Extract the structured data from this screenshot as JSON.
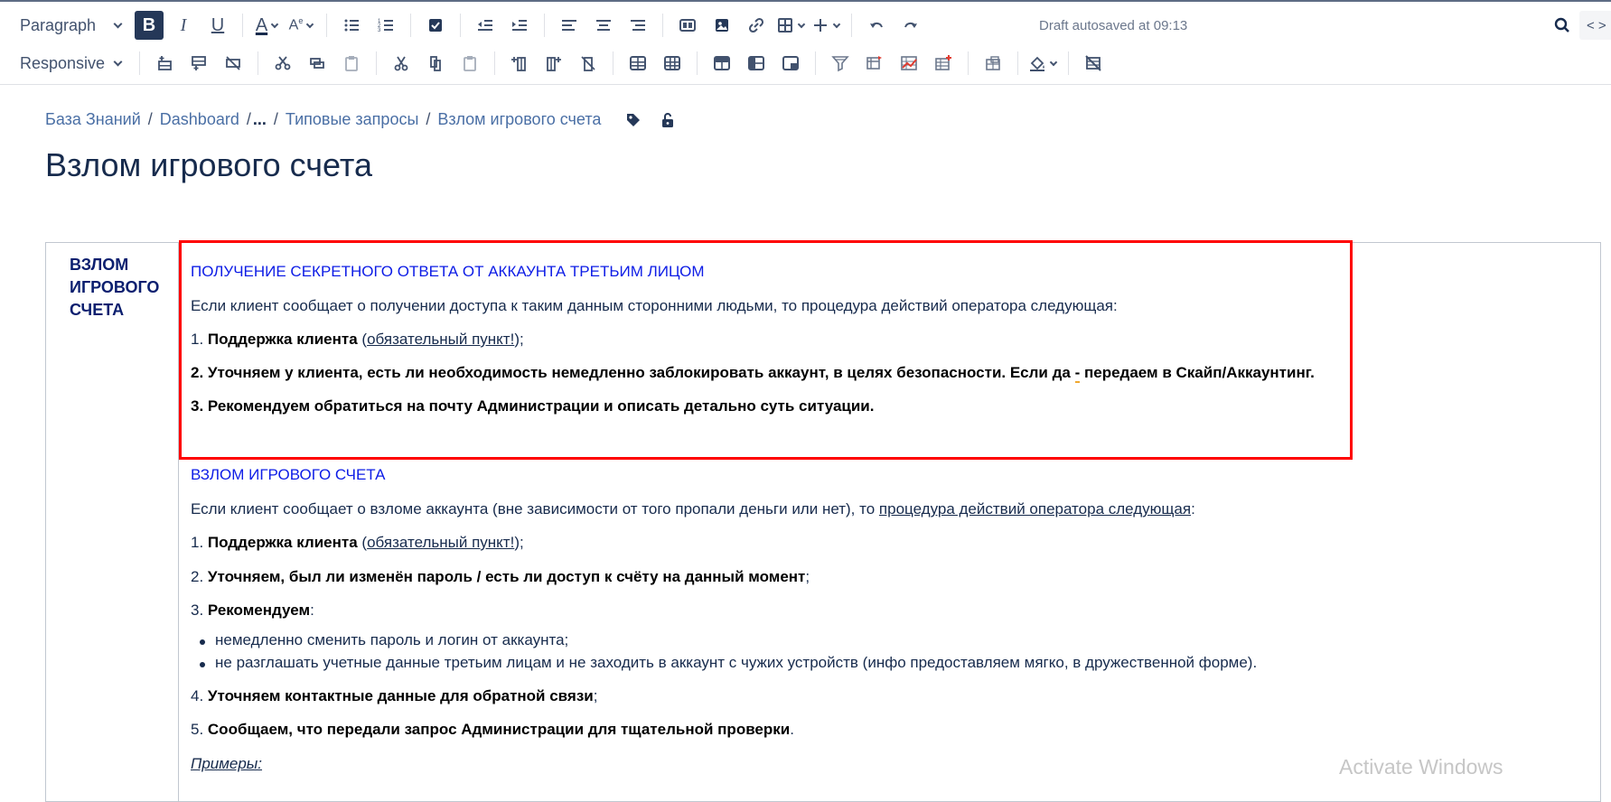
{
  "toolbar": {
    "paragraph_dropdown": "Paragraph",
    "responsive_dropdown": "Responsive",
    "autosave_text": "Draft autosaved at 09:13",
    "code_label": "< >"
  },
  "breadcrumb": {
    "items": [
      "База Знаний",
      "Dashboard",
      "...",
      "Типовые запросы",
      "Взлом игрового счета"
    ]
  },
  "page": {
    "title": "Взлом игрового счета"
  },
  "table": {
    "side_heading": "ВЗЛОМ ИГРОВОГО СЧЕТА",
    "section1": {
      "title": "ПОЛУЧЕНИЕ СЕКРЕТНОГО ОТВЕТА ОТ АККАУНТА ТРЕТЬИМ ЛИЦОМ",
      "intro": "Если клиент сообщает о получении доступа к таким данным сторонними людьми, то процедура действий оператора следующая:",
      "step1_num": "1. ",
      "step1_bold": "Поддержка клиента",
      "step1_link": "обязательный пункт!",
      "step2": "2. Уточняем у клиента, есть ли необходимость немедленно заблокировать аккаунт, в целях безопасности. Если да",
      "step2_dash": "-",
      "step2_end": "передаем в Скайп/Аккаунтинг.",
      "step3": "3.  Рекомендуем обратиться на почту Администрации и описать детально суть ситуации."
    },
    "section2": {
      "title": "ВЗЛОМ ИГРОВОГО СЧЕТА",
      "intro_pre": "Если клиент сообщает о взломе аккаунта (вне зависимости от того пропали деньги или нет), то ",
      "intro_link": "процедура действий оператора следующая",
      "step1_num": "1. ",
      "step1_bold": "Поддержка клиента",
      "step1_link": "обязательный пункт!",
      "step2_num": "2. ",
      "step2_bold": "Уточняем, был ли изменён пароль / есть ли доступ к счёту на данный момент",
      "step3_num": "3. ",
      "step3_bold": "Рекомендуем",
      "bullets": [
        "немедленно сменить пароль и логин от аккаунта;",
        "не разглашать учетные данные третьим лицам и не заходить в аккаунт с чужих устройств (инфо предоставляем мягко, в дружественной форме)."
      ],
      "step4_num": "4. ",
      "step4_bold": "Уточняем контактные данные для обратной связи",
      "step5_num": "5. ",
      "step5_bold": "Сообщаем, что передали запрос Администрации для тщательной проверки",
      "examples": "Примеры:"
    }
  },
  "overlay": {
    "watermark": "Activate Windows",
    "highlight_color": "#ff0000"
  }
}
